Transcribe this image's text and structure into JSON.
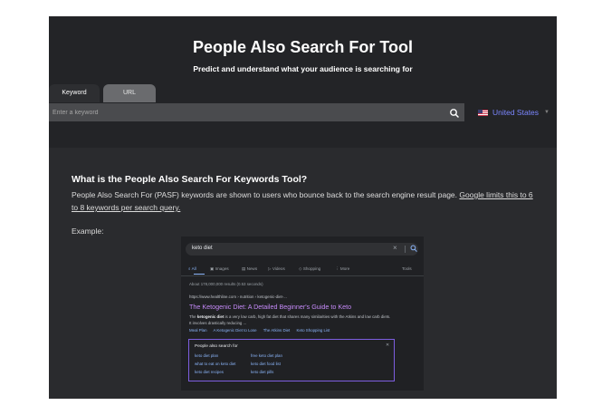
{
  "header": {
    "title": "People Also Search For Tool",
    "subtitle": "Predict and understand what your audience is searching for"
  },
  "tabs": [
    {
      "label": "Keyword",
      "active": true
    },
    {
      "label": "URL",
      "active": false
    }
  ],
  "search": {
    "placeholder": "Enter a keyword",
    "value": "",
    "icon": "search-icon"
  },
  "country": {
    "label": "United States",
    "flag": "us-flag-icon",
    "accent": "#7b86ff"
  },
  "content": {
    "heading": "What is the People Also Search For Keywords Tool?",
    "paragraph_text": "People Also Search For (PASF) keywords are shown to users who bounce back to the search engine result page.",
    "paragraph_link": "Google limits this to 6 to 8 keywords per search query.",
    "example_label": "Example:"
  },
  "example": {
    "query": "keto diet",
    "tabs": [
      "All",
      "Images",
      "News",
      "Videos",
      "Shopping",
      "More",
      "Tools"
    ],
    "results_count": "About 178,000,000 results (0.53 seconds)",
    "result_url": "https://www.healthline.com › nutrition › ketogenic-diet-...",
    "result_title": "The Ketogenic Diet: A Detailed Beginner's Guide to Keto",
    "snippet_lead": "The ",
    "snippet_bold": "ketogenic diet",
    "snippet_rest": " is a very low carb, high fat diet that shares many similarities with the Atkins and low carb diets. It involves drastically reducing ...",
    "sitelinks": [
      "Meal Plan",
      "A Ketogenic Diet to Lose",
      "The Atkins Diet",
      "Keto Shopping List"
    ],
    "pasf_title": "People also search for",
    "pasf_items": [
      "keto diet plan",
      "free keto diet plan",
      "what to eat on keto diet",
      "keto diet food list",
      "keto diet recipes",
      "keto diet pills"
    ],
    "pasf_border": "#7d5ee0"
  }
}
